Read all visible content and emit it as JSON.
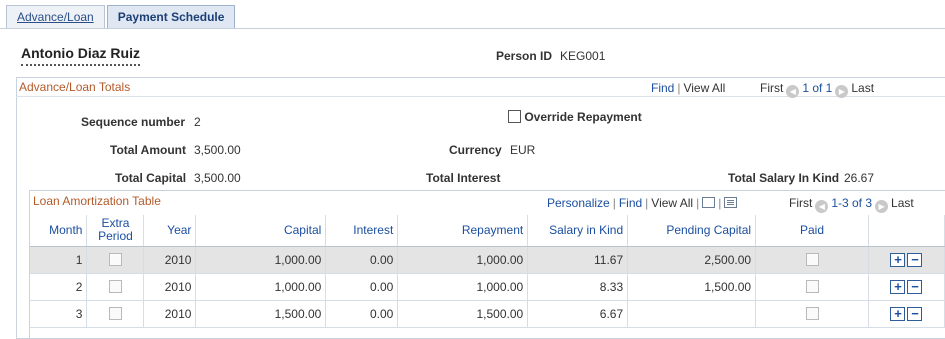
{
  "tabs": [
    "Advance/Loan",
    "Payment Schedule"
  ],
  "person": {
    "name": "Antonio Diaz Ruiz",
    "id_label": "Person ID",
    "id_value": "KEG001"
  },
  "totals": {
    "title": "Advance/Loan Totals",
    "nav": {
      "find": "Find",
      "view_all": "View All",
      "first": "First",
      "range": "1 of 1",
      "last": "Last"
    },
    "sequence_label": "Sequence number",
    "sequence_value": "2",
    "override_label": "Override Repayment",
    "total_amount_label": "Total Amount",
    "total_amount_value": "3,500.00",
    "currency_label": "Currency",
    "currency_value": "EUR",
    "total_capital_label": "Total Capital",
    "total_capital_value": "3,500.00",
    "total_interest_label": "Total Interest",
    "salary_kind_label": "Total Salary In Kind",
    "salary_kind_value": "26.67"
  },
  "grid": {
    "title": "Loan Amortization Table",
    "nav": {
      "personalize": "Personalize",
      "find": "Find",
      "view_all": "View All",
      "first": "First",
      "range": "1-3 of 3",
      "last": "Last"
    },
    "columns": [
      "Month",
      "Extra Period",
      "Year",
      "Capital",
      "Interest",
      "Repayment",
      "Salary in Kind",
      "Pending Capital",
      "Paid"
    ],
    "rows": [
      [
        "1",
        "2010",
        "1,000.00",
        "0.00",
        "1,000.00",
        "11.67",
        "2,500.00"
      ],
      [
        "2",
        "2010",
        "1,000.00",
        "0.00",
        "1,000.00",
        "8.33",
        "1,500.00"
      ],
      [
        "3",
        "2010",
        "1,500.00",
        "0.00",
        "1,500.00",
        "6.67",
        ""
      ]
    ],
    "add_symbol": "+",
    "remove_symbol": "−"
  }
}
